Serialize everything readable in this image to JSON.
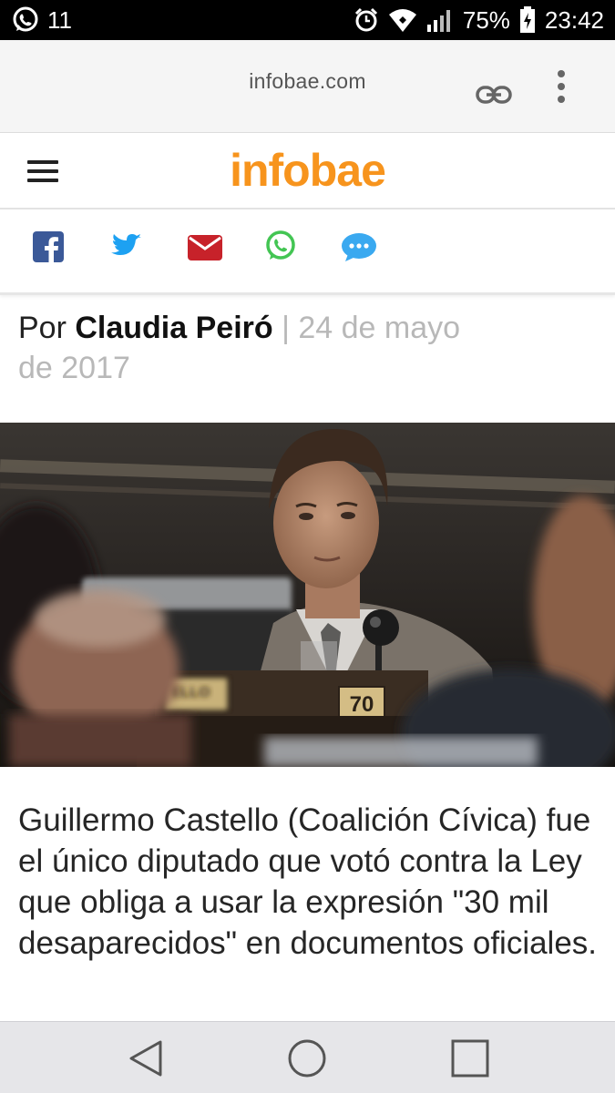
{
  "status_bar": {
    "notification_count": "11",
    "battery": "75%",
    "time": "23:42",
    "icons": [
      "whatsapp-icon",
      "alarm-icon",
      "wifi-icon",
      "signal-icon",
      "battery-icon"
    ]
  },
  "browser": {
    "url": "infobae.com",
    "icons": [
      "link-icon",
      "overflow-menu-icon"
    ]
  },
  "site": {
    "logo": "infobae",
    "logo_color": "#f7941d",
    "menu_icon": "hamburger-menu-icon"
  },
  "share": [
    {
      "name": "facebook-icon",
      "color": "#3b5998"
    },
    {
      "name": "twitter-icon",
      "color": "#1da1f2"
    },
    {
      "name": "email-icon",
      "color": "#c7222a"
    },
    {
      "name": "whatsapp-share-icon",
      "color": "#43c553"
    },
    {
      "name": "sms-icon",
      "color": "#3aa9f0"
    }
  ],
  "article": {
    "by": "Por ",
    "author": "Claudia Peiró",
    "separator": " | ",
    "date": "24 de mayo de 2017",
    "image_nameplate": "ELLO",
    "image_seat_number": "70",
    "caption": "Guillermo Castello (Coalición Cívica) fue el único diputado que votó contra la Ley que obliga a usar la expresión \"30 mil desaparecidos\" en documentos oficiales."
  },
  "nav_bar": {
    "buttons": [
      "back-button",
      "home-button",
      "recents-button"
    ]
  }
}
